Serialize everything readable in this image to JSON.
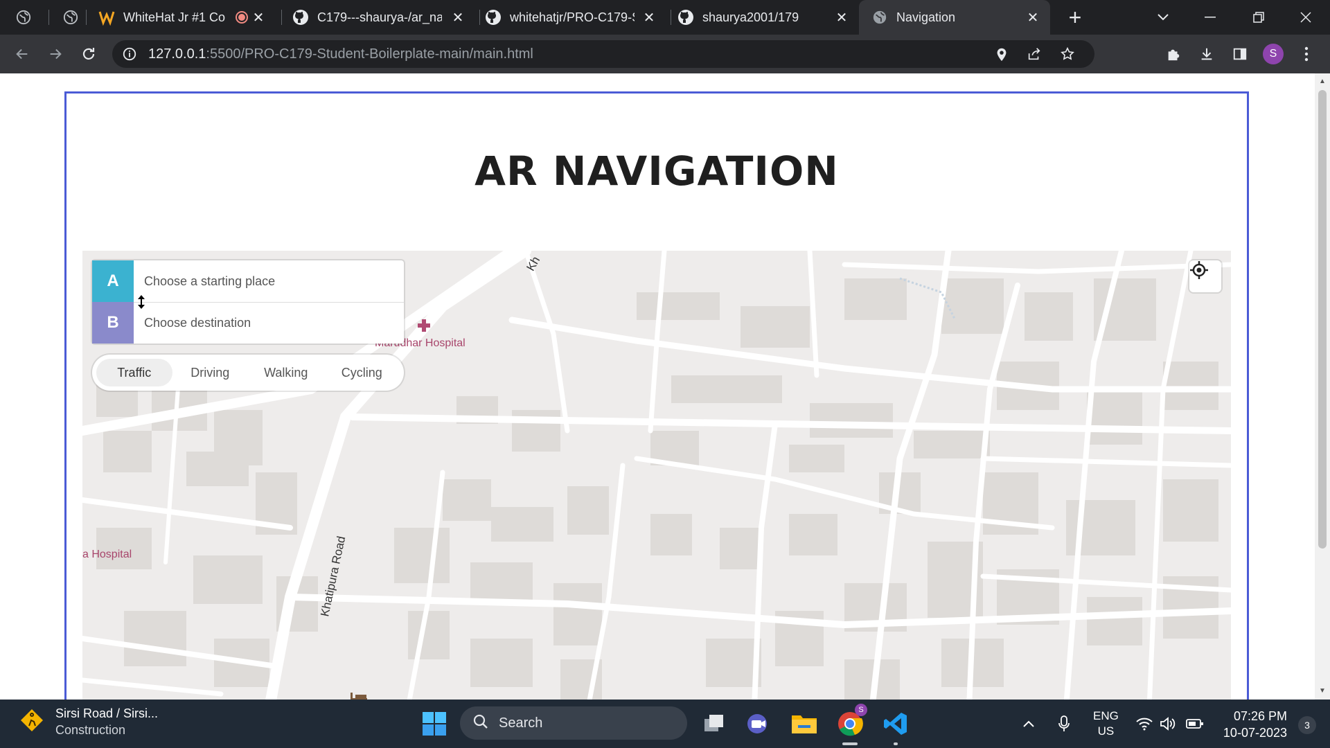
{
  "browser": {
    "tabs": [
      {
        "title": "",
        "favicon": "globe-icon"
      },
      {
        "title": "",
        "favicon": "globe-icon"
      },
      {
        "title": "WhiteHat Jr #1 Co",
        "favicon": "whitehat-icon"
      },
      {
        "title": "C179---shaurya-/ar_na",
        "favicon": "github-icon"
      },
      {
        "title": "whitehatjr/PRO-C179-S",
        "favicon": "github-icon"
      },
      {
        "title": "shaurya2001/179",
        "favicon": "github-icon"
      },
      {
        "title": "Navigation",
        "favicon": "globe-icon"
      }
    ],
    "new_tab": "+",
    "url_host": "127.0.0.1",
    "url_rest": ":5500/PRO-C179-Student-Boilerplate-main/main.html",
    "profile_initial": "S"
  },
  "page": {
    "title": "AR NAVIGATION"
  },
  "directions": {
    "origin_badge": "A",
    "origin_placeholder": "Choose a starting place",
    "destination_badge": "B",
    "destination_placeholder": "Choose destination",
    "profiles": [
      "Traffic",
      "Driving",
      "Walking",
      "Cycling"
    ],
    "selected_profile": "Traffic"
  },
  "map": {
    "labels": {
      "hospital_1": "Marudhar Hospital",
      "hospital_2": "a Hospital",
      "road_1": "Khatipura Road",
      "road_2": "Kh"
    }
  },
  "taskbar": {
    "weather_title": "Sirsi Road / Sirsi...",
    "weather_sub": "Construction",
    "search_label": "Search",
    "lang_1": "ENG",
    "lang_2": "US",
    "time": "07:26 PM",
    "date": "10-07-2023",
    "notification_count": "3",
    "chrome_badge": "S"
  },
  "colors": {
    "frame_border": "#4b5bd6",
    "badge_a": "#3bb2d0",
    "badge_b": "#8a8acb",
    "hospital": "#a8456b"
  }
}
